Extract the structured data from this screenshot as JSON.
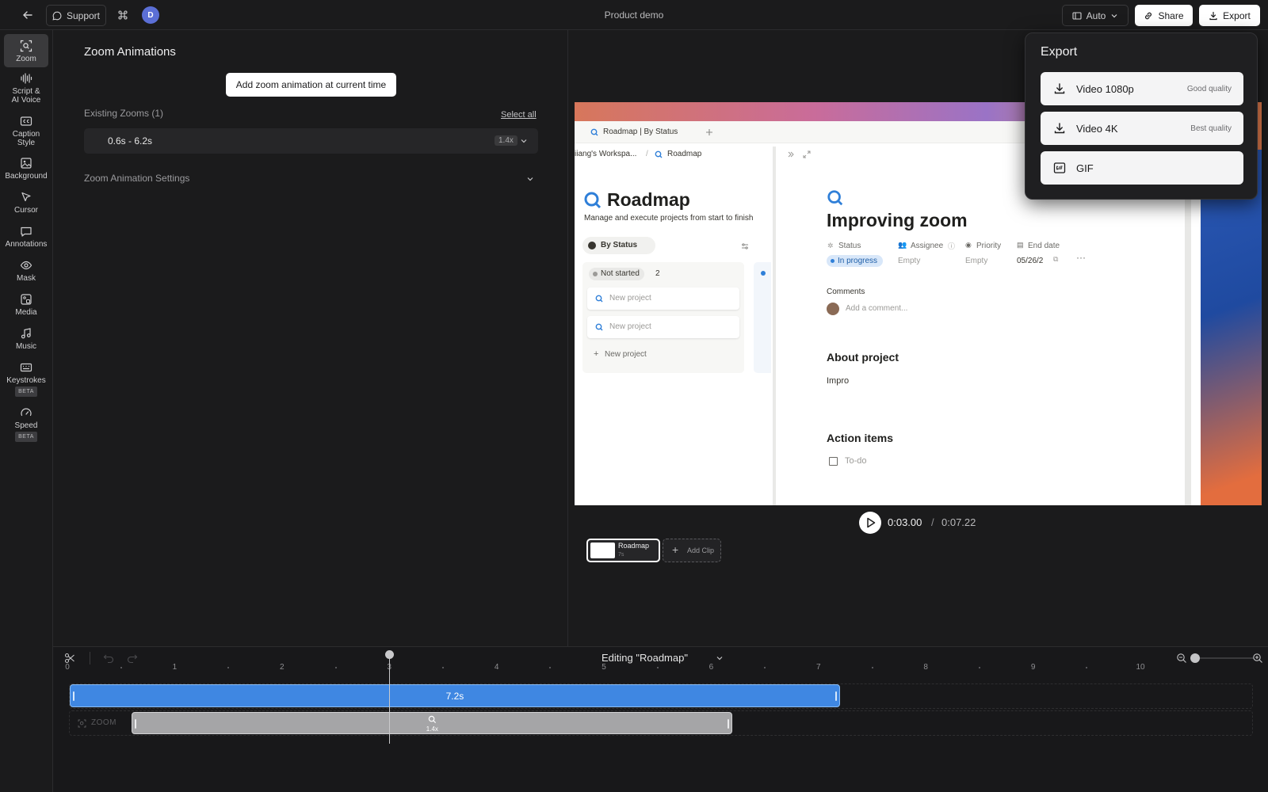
{
  "topbar": {
    "support_label": "Support",
    "avatar_initial": "D",
    "title": "Product demo",
    "auto_label": "Auto",
    "share_label": "Share",
    "export_label": "Export"
  },
  "sidebar": {
    "items": [
      {
        "label": "Zoom",
        "icon": "zoom-icon"
      },
      {
        "label": "Script &",
        "label2": "AI Voice",
        "icon": "waveform-icon"
      },
      {
        "label": "Caption",
        "label2": "Style",
        "icon": "caption-icon"
      },
      {
        "label": "Background",
        "icon": "image-icon"
      },
      {
        "label": "Cursor",
        "icon": "cursor-icon"
      },
      {
        "label": "Annotations",
        "icon": "chat-bubble-icon"
      },
      {
        "label": "Mask",
        "icon": "eye-icon"
      },
      {
        "label": "Media",
        "icon": "media-icon"
      },
      {
        "label": "Music",
        "icon": "music-note-icon"
      },
      {
        "label": "Keystrokes",
        "badge": "BETA",
        "icon": "keyboard-icon"
      },
      {
        "label": "Speed",
        "badge": "BETA",
        "icon": "speedometer-icon"
      }
    ]
  },
  "panel": {
    "title": "Zoom Animations",
    "add_button": "Add zoom animation at current time",
    "existing_label": "Existing Zooms (1)",
    "select_all": "Select all",
    "zoom_item": {
      "range": "0.6s - 6.2s",
      "scale": "1.4x"
    },
    "settings_label": "Zoom Animation Settings"
  },
  "preview": {
    "tab_title": "Roadmap | By Status",
    "breadcrumb_ws": "iiang's Workspa...",
    "breadcrumb_page": "Roadmap",
    "page_title": "Roadmap",
    "page_desc": "Manage and execute projects from start to finish",
    "view_label": "By Status",
    "group_label": "Not started",
    "group_count": "2",
    "card1": "New project",
    "card2": "New project",
    "add_card": "New project",
    "detail_title": "Improving zoom",
    "props": {
      "status_label": "Status",
      "status_value": "In progress",
      "assignee_label": "Assignee",
      "assignee_value": "Empty",
      "priority_label": "Priority",
      "priority_value": "Empty",
      "end_label": "End date",
      "end_value": "05/26/2"
    },
    "comments_label": "Comments",
    "comment_placeholder": "Add a comment...",
    "about_heading": "About project",
    "about_text": "Impro",
    "action_heading": "Action items",
    "todo": "To-do",
    "current_time": "0:03.00",
    "separator": "/",
    "total_time": "0:07.22",
    "clip_name": "Roadmap",
    "clip_duration": "7s",
    "add_clip": "Add Clip"
  },
  "export_menu": {
    "title": "Export",
    "options": [
      {
        "label": "Video 1080p",
        "note": "Good quality",
        "icon": "download-icon"
      },
      {
        "label": "Video 4K",
        "note": "Best quality",
        "icon": "download-icon"
      },
      {
        "label": "GIF",
        "note": "",
        "icon": "gif-icon"
      }
    ]
  },
  "timeline": {
    "editing_label": "Editing \"Roadmap\"",
    "ticks": [
      "0",
      "1",
      "2",
      "3",
      "4",
      "5",
      "6",
      "7",
      "8",
      "9",
      "10"
    ],
    "clip_label": "7.2s",
    "zoom_track_label": "ZOOM",
    "zoom_scale": "1.4x",
    "playhead_s": 3.0,
    "clip_s": 7.2,
    "zoom_start_s": 0.6,
    "zoom_end_s": 6.2,
    "zoom_slider": 0.0
  },
  "colors": {
    "accent": "#3d86e0",
    "clip_blue": "#3f87e2",
    "zoom_gray": "#a5a5a7",
    "avatar": "#5b6fd6"
  }
}
